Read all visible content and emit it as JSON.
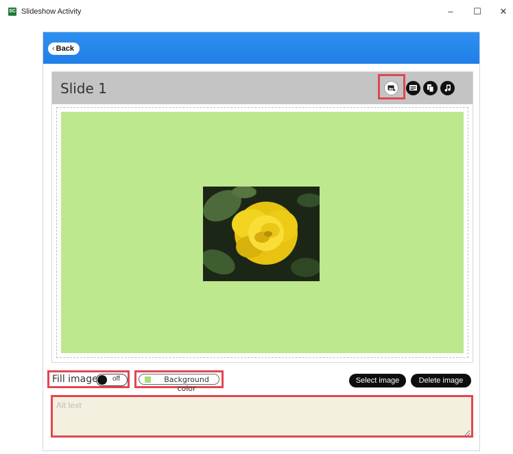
{
  "window": {
    "app_icon_text": "SC",
    "title": "Slideshow Activity",
    "minimize_glyph": "–",
    "maximize_glyph": "☐",
    "close_glyph": "✕"
  },
  "header": {
    "back_label": "Back",
    "back_icon": "chevron-left-icon"
  },
  "slide": {
    "title": "Slide 1",
    "tools": [
      {
        "name": "add-image",
        "icon": "image-plus-icon"
      },
      {
        "name": "add-text",
        "icon": "text-card-icon"
      },
      {
        "name": "copy",
        "icon": "layers-icon"
      },
      {
        "name": "audio",
        "icon": "music-note-icon"
      }
    ],
    "canvas_color": "#bde88e",
    "image_subject": "yellow rose"
  },
  "controls": {
    "fill_image_label": "Fill image",
    "fill_image_state": "off",
    "background_color_label": "Background color",
    "background_swatch": "#a9dc7d",
    "select_image_label": "Select image",
    "delete_image_label": "Delete image"
  },
  "alt_text": {
    "value": "",
    "placeholder": "Alt text"
  },
  "colors": {
    "header_blue": "#2586ec",
    "highlight_red": "#e2464f",
    "slide_header_gray": "#c4c4c4"
  }
}
